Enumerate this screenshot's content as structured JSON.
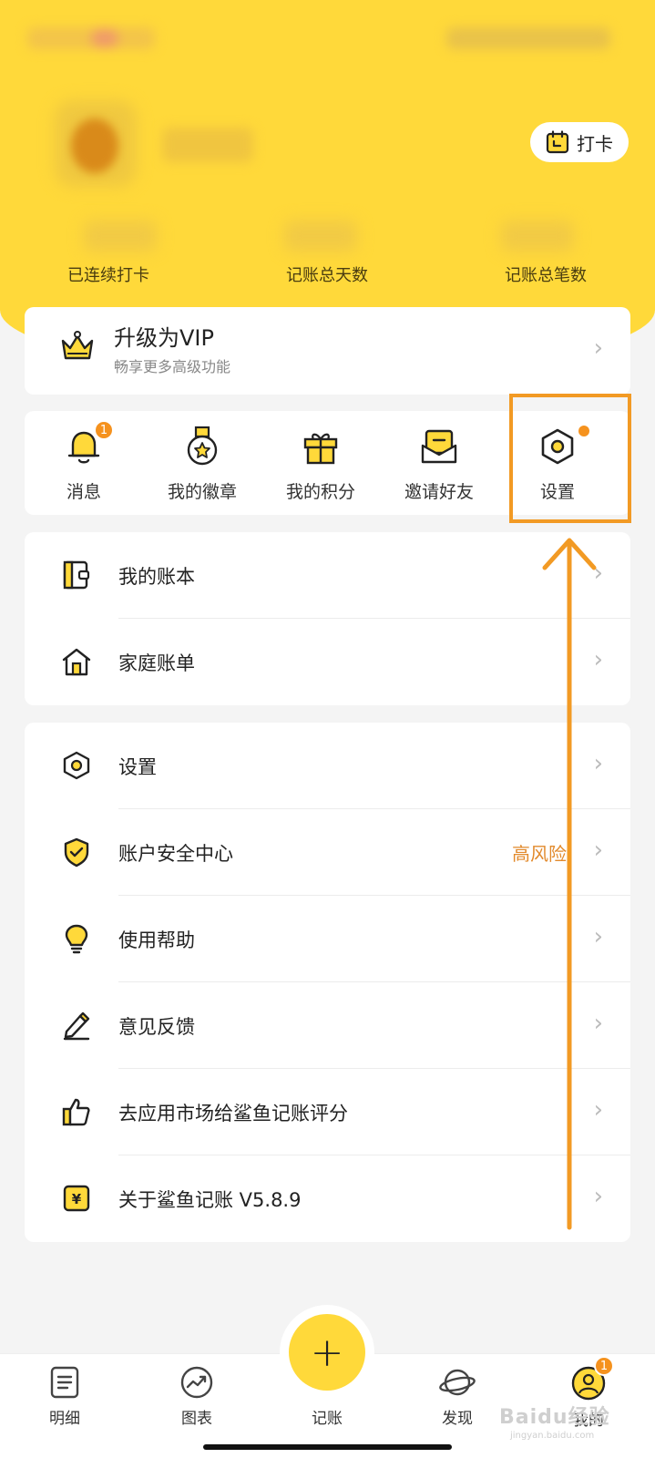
{
  "header": {
    "checkin_label": "打卡",
    "stats": [
      {
        "label": "已连续打卡"
      },
      {
        "label": "记账总天数"
      },
      {
        "label": "记账总笔数"
      }
    ]
  },
  "vip": {
    "title": "升级为VIP",
    "subtitle": "畅享更多高级功能"
  },
  "quick_actions": [
    {
      "label": "消息",
      "icon": "bell-icon",
      "badge": "1"
    },
    {
      "label": "我的徽章",
      "icon": "medal-icon"
    },
    {
      "label": "我的积分",
      "icon": "gift-icon"
    },
    {
      "label": "邀请好友",
      "icon": "invite-envelope-icon"
    },
    {
      "label": "设置",
      "icon": "settings-hexagon-icon",
      "dot": true
    }
  ],
  "list_group_1": [
    {
      "label": "我的账本",
      "icon": "ledger-icon"
    },
    {
      "label": "家庭账单",
      "icon": "house-icon"
    }
  ],
  "list_group_2": [
    {
      "label": "设置",
      "icon": "settings-hexagon-icon"
    },
    {
      "label": "账户安全中心",
      "icon": "shield-check-icon",
      "extra": "高风险"
    },
    {
      "label": "使用帮助",
      "icon": "lightbulb-icon"
    },
    {
      "label": "意见反馈",
      "icon": "pencil-icon"
    },
    {
      "label": "去应用市场给鲨鱼记账评分",
      "icon": "thumbs-up-icon"
    },
    {
      "label": "关于鲨鱼记账 V5.8.9",
      "icon": "yen-badge-icon"
    }
  ],
  "tabbar": {
    "tabs": [
      {
        "label": "明细",
        "icon": "list-document-icon"
      },
      {
        "label": "图表",
        "icon": "trend-chart-icon"
      },
      {
        "label": "记账",
        "icon": "plus-icon"
      },
      {
        "label": "发现",
        "icon": "planet-icon"
      },
      {
        "label": "我的",
        "icon": "user-profile-icon",
        "badge": "1"
      }
    ],
    "add_symbol": "+"
  },
  "watermark": {
    "text": "Baidu经验",
    "sub": "jingyan.baidu.com"
  },
  "colors": {
    "brand_yellow": "#ffd93a",
    "badge_orange": "#f5921e",
    "annotation_orange": "#f29a24",
    "warning_text": "#e28a2c"
  }
}
